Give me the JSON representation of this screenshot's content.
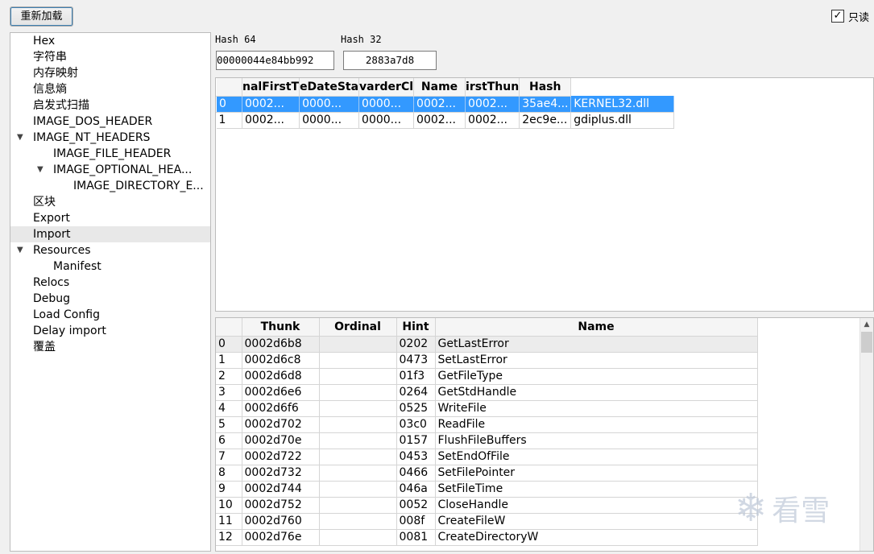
{
  "toolbar": {
    "reload_label": "重新加载"
  },
  "readonly": {
    "label": "只读",
    "checked": "✓"
  },
  "tree": {
    "items": [
      {
        "label": "Hex"
      },
      {
        "label": "字符串"
      },
      {
        "label": "内存映射"
      },
      {
        "label": "信息熵"
      },
      {
        "label": "启发式扫描"
      },
      {
        "label": "IMAGE_DOS_HEADER"
      },
      {
        "label": "IMAGE_NT_HEADERS"
      },
      {
        "label": "IMAGE_FILE_HEADER"
      },
      {
        "label": "IMAGE_OPTIONAL_HEA..."
      },
      {
        "label": "IMAGE_DIRECTORY_E..."
      },
      {
        "label": "区块"
      },
      {
        "label": "Export"
      },
      {
        "label": "Import"
      },
      {
        "label": "Resources"
      },
      {
        "label": "Manifest"
      },
      {
        "label": "Relocs"
      },
      {
        "label": "Debug"
      },
      {
        "label": "Load Config"
      },
      {
        "label": "Delay import"
      },
      {
        "label": "覆盖"
      }
    ]
  },
  "hash": {
    "hash64_label": "Hash 64",
    "hash64_value": "00000044e84bb992",
    "hash32_label": "Hash 32",
    "hash32_value": "2883a7d8"
  },
  "dll_table": {
    "headers": [
      "nalFirstT",
      "eDateSta",
      "varderCl",
      "Name",
      "irstThun",
      "Hash"
    ],
    "rows": [
      {
        "idx": "0",
        "c1": "0002...",
        "c2": "0000...",
        "c3": "0000...",
        "c4": "0002...",
        "c5": "0002...",
        "c6": "35ae4...",
        "name": "KERNEL32.dll"
      },
      {
        "idx": "1",
        "c1": "0002...",
        "c2": "0000...",
        "c3": "0000...",
        "c4": "0002...",
        "c5": "0002...",
        "c6": "2ec9e...",
        "name": "gdiplus.dll"
      }
    ]
  },
  "func_table": {
    "headers": [
      "Thunk",
      "Ordinal",
      "Hint",
      "Name"
    ],
    "rows": [
      {
        "idx": "0",
        "thunk": "0002d6b8",
        "ordinal": "",
        "hint": "0202",
        "name": "GetLastError"
      },
      {
        "idx": "1",
        "thunk": "0002d6c8",
        "ordinal": "",
        "hint": "0473",
        "name": "SetLastError"
      },
      {
        "idx": "2",
        "thunk": "0002d6d8",
        "ordinal": "",
        "hint": "01f3",
        "name": "GetFileType"
      },
      {
        "idx": "3",
        "thunk": "0002d6e6",
        "ordinal": "",
        "hint": "0264",
        "name": "GetStdHandle"
      },
      {
        "idx": "4",
        "thunk": "0002d6f6",
        "ordinal": "",
        "hint": "0525",
        "name": "WriteFile"
      },
      {
        "idx": "5",
        "thunk": "0002d702",
        "ordinal": "",
        "hint": "03c0",
        "name": "ReadFile"
      },
      {
        "idx": "6",
        "thunk": "0002d70e",
        "ordinal": "",
        "hint": "0157",
        "name": "FlushFileBuffers"
      },
      {
        "idx": "7",
        "thunk": "0002d722",
        "ordinal": "",
        "hint": "0453",
        "name": "SetEndOfFile"
      },
      {
        "idx": "8",
        "thunk": "0002d732",
        "ordinal": "",
        "hint": "0466",
        "name": "SetFilePointer"
      },
      {
        "idx": "9",
        "thunk": "0002d744",
        "ordinal": "",
        "hint": "046a",
        "name": "SetFileTime"
      },
      {
        "idx": "10",
        "thunk": "0002d752",
        "ordinal": "",
        "hint": "0052",
        "name": "CloseHandle"
      },
      {
        "idx": "11",
        "thunk": "0002d760",
        "ordinal": "",
        "hint": "008f",
        "name": "CreateFileW"
      },
      {
        "idx": "12",
        "thunk": "0002d76e",
        "ordinal": "",
        "hint": "0081",
        "name": "CreateDirectoryW"
      }
    ]
  },
  "watermark": {
    "text": "看雪",
    "icon": "snowflake-logo"
  },
  "colors": {
    "selection": "#3399ff",
    "hover_row": "#ececec"
  }
}
